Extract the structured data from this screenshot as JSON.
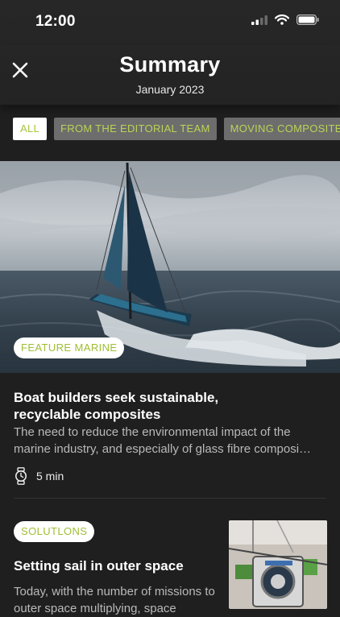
{
  "status": {
    "time": "12:00"
  },
  "header": {
    "title": "Summary",
    "subtitle": "January 2023"
  },
  "tabs": [
    {
      "label": "ALL",
      "active": true
    },
    {
      "label": "FROM THE EDITORIAL TEAM",
      "active": false
    },
    {
      "label": "MOVING COMPOSITES",
      "active": false
    }
  ],
  "articles": [
    {
      "category": "FEATURE MARINE",
      "title": "Boat builders seek sustainable, recyclable composites",
      "excerpt": "The need to reduce the environmental impact of the marine industry, and especially of glass fibre composi…",
      "read_time": "5 min"
    },
    {
      "category": "SOLUTLONS",
      "title": "Setting sail in outer space",
      "excerpt": "Today, with the number of missions to outer space multiplying, space"
    }
  ],
  "colors": {
    "accent": "#a6c63c",
    "background": "#1f1f1f"
  }
}
